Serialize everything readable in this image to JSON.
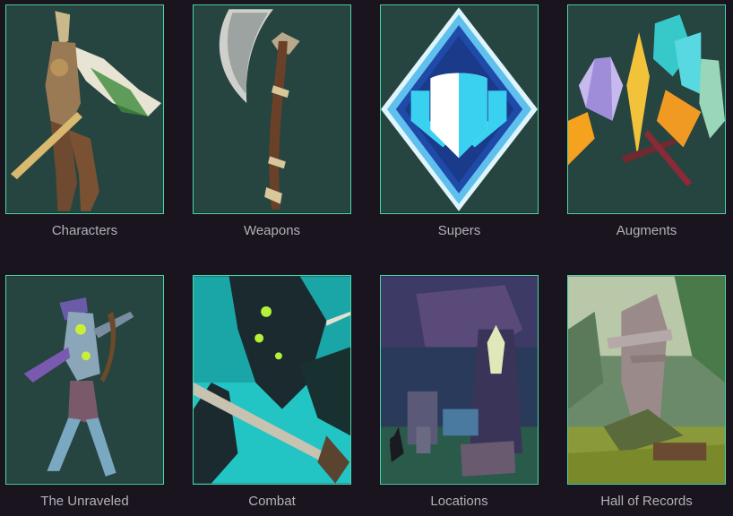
{
  "cards": [
    {
      "label": "Characters",
      "icon": "character-hero-art"
    },
    {
      "label": "Weapons",
      "icon": "axe-weapon-art"
    },
    {
      "label": "Supers",
      "icon": "crest-emblem-icon"
    },
    {
      "label": "Augments",
      "icon": "crystal-shards-art"
    },
    {
      "label": "The Unraveled",
      "icon": "unraveled-warrior-art"
    },
    {
      "label": "Combat",
      "icon": "combat-scene-art"
    },
    {
      "label": "Locations",
      "icon": "ruins-location-art"
    },
    {
      "label": "Hall of Records",
      "icon": "hall-records-art"
    }
  ],
  "colors": {
    "background": "#19141e",
    "tile_bg": "#264440",
    "tile_border": "#4ad6a8",
    "label_text": "#b3b1b8",
    "super_blue": "#1f4aa8",
    "super_cyan": "#3ad1f0"
  }
}
